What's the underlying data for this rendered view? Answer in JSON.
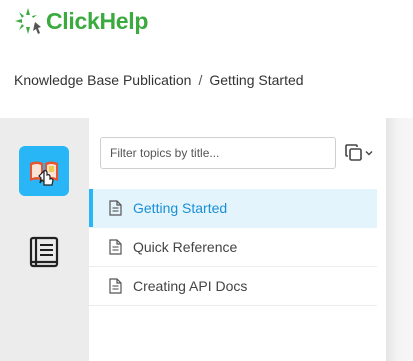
{
  "brand": {
    "name": "ClickHelp",
    "accent": "#3bab3f"
  },
  "breadcrumb": {
    "items": [
      "Knowledge Base Publication",
      "Getting Started"
    ],
    "separator": "/"
  },
  "rail": {
    "items": [
      {
        "icon": "book-open-icon",
        "active": true
      },
      {
        "icon": "book-icon",
        "active": false
      }
    ]
  },
  "toc": {
    "filter_placeholder": "Filter topics by title...",
    "filter_value": "",
    "topics": [
      {
        "label": "Getting Started",
        "active": true,
        "icon": "document-icon"
      },
      {
        "label": "Quick Reference",
        "active": false,
        "icon": "document-icon"
      },
      {
        "label": "Creating API Docs",
        "active": false,
        "icon": "document-icon"
      }
    ]
  },
  "colors": {
    "active_accent": "#29b6f6",
    "active_text": "#1a8fd6"
  }
}
